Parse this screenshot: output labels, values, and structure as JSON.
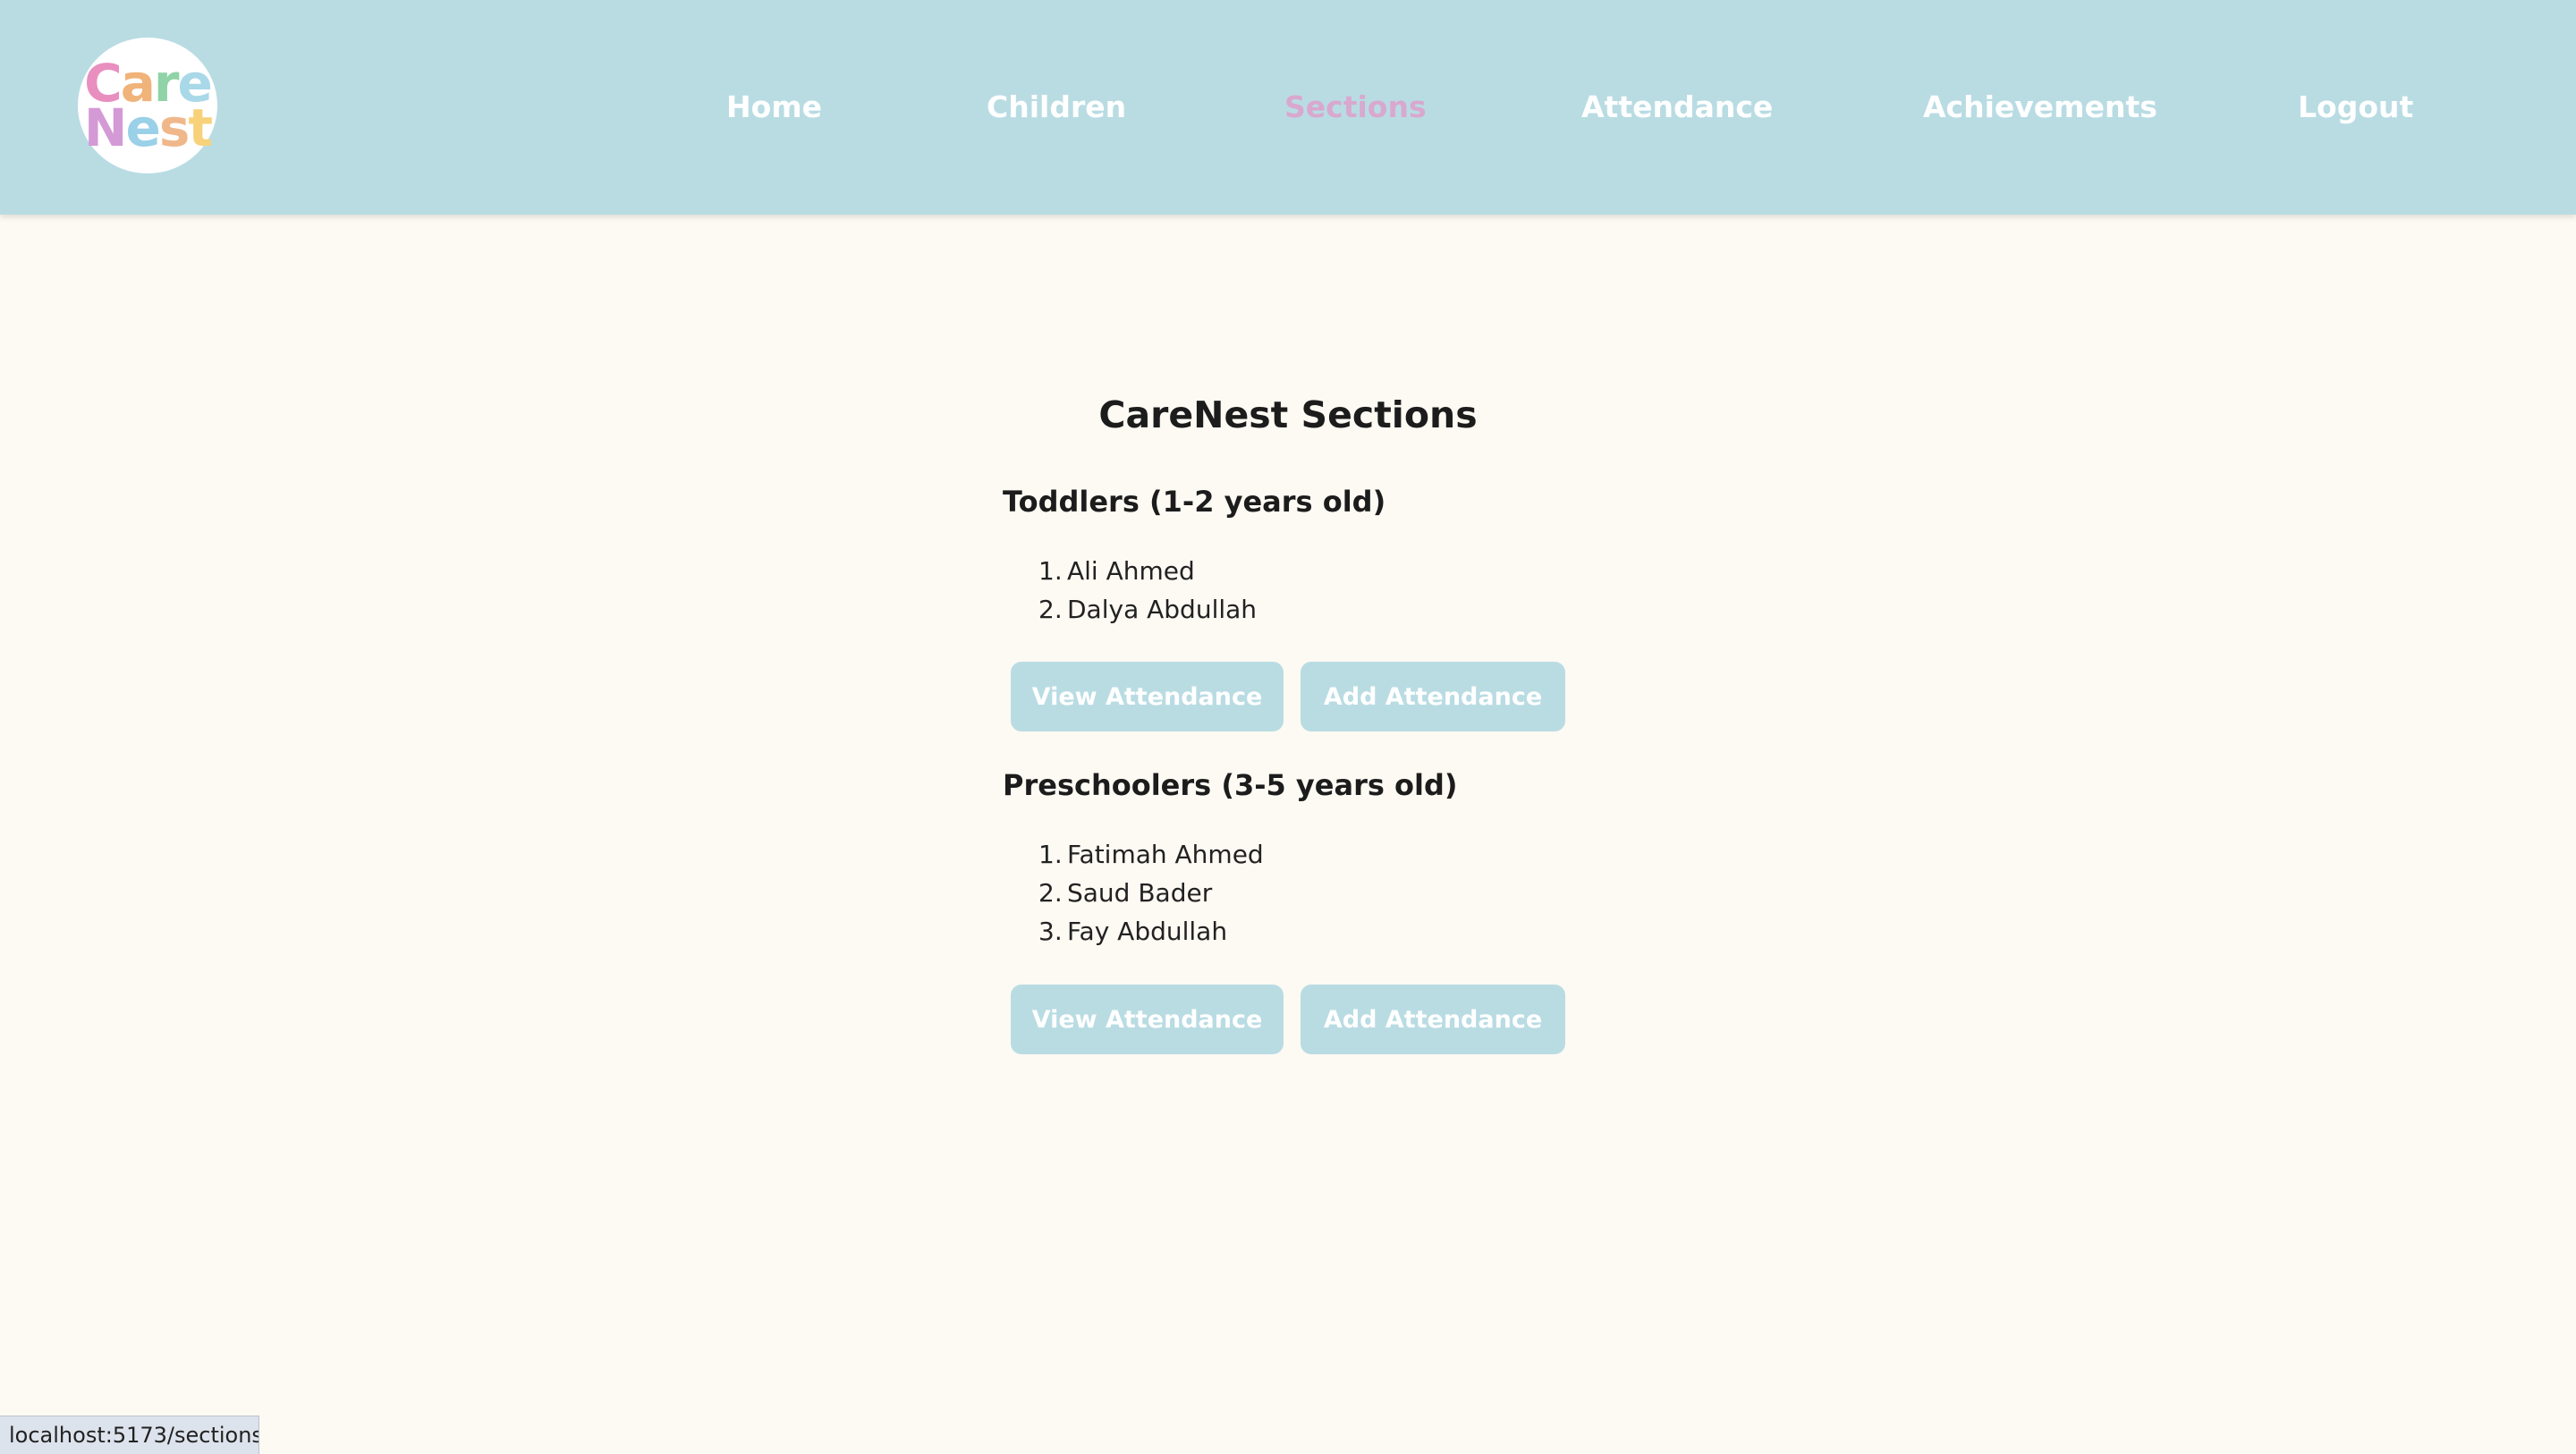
{
  "app": {
    "logo": {
      "line1": "Care",
      "line2": "Nest",
      "line1_letters": [
        {
          "ch": "C",
          "color": "#e98fc0"
        },
        {
          "ch": "a",
          "color": "#f0b37a"
        },
        {
          "ch": "r",
          "color": "#8fd3a6"
        },
        {
          "ch": "e",
          "color": "#a9d8e8"
        }
      ],
      "line2_letters": [
        {
          "ch": "N",
          "color": "#d49ad6"
        },
        {
          "ch": "e",
          "color": "#9ad0e8"
        },
        {
          "ch": "s",
          "color": "#f0b88a"
        },
        {
          "ch": "t",
          "color": "#f7d27a"
        }
      ]
    }
  },
  "nav": {
    "items": [
      {
        "label": "Home",
        "active": false
      },
      {
        "label": "Children",
        "active": false
      },
      {
        "label": "Sections",
        "active": true
      },
      {
        "label": "Attendance",
        "active": false
      },
      {
        "label": "Achievements",
        "active": false
      },
      {
        "label": "Logout",
        "active": false
      }
    ]
  },
  "main": {
    "title": "CareNest Sections",
    "sections": [
      {
        "heading": "Toddlers (1-2 years old)",
        "children": [
          "Ali Ahmed",
          "Dalya Abdullah"
        ],
        "view_button": "View Attendance",
        "add_button": "Add Attendance"
      },
      {
        "heading": "Preschoolers (3-5 years old)",
        "children": [
          "Fatimah Ahmed",
          "Saud Bader",
          "Fay Abdullah"
        ],
        "view_button": "View Attendance",
        "add_button": "Add Attendance"
      }
    ]
  },
  "status_bar": {
    "url": "localhost:5173/sections"
  },
  "colors": {
    "nav_background": "#b9dce3",
    "nav_active": "#d9a8cf",
    "page_background": "#fdfaf3",
    "button_background": "#b9dce3"
  }
}
